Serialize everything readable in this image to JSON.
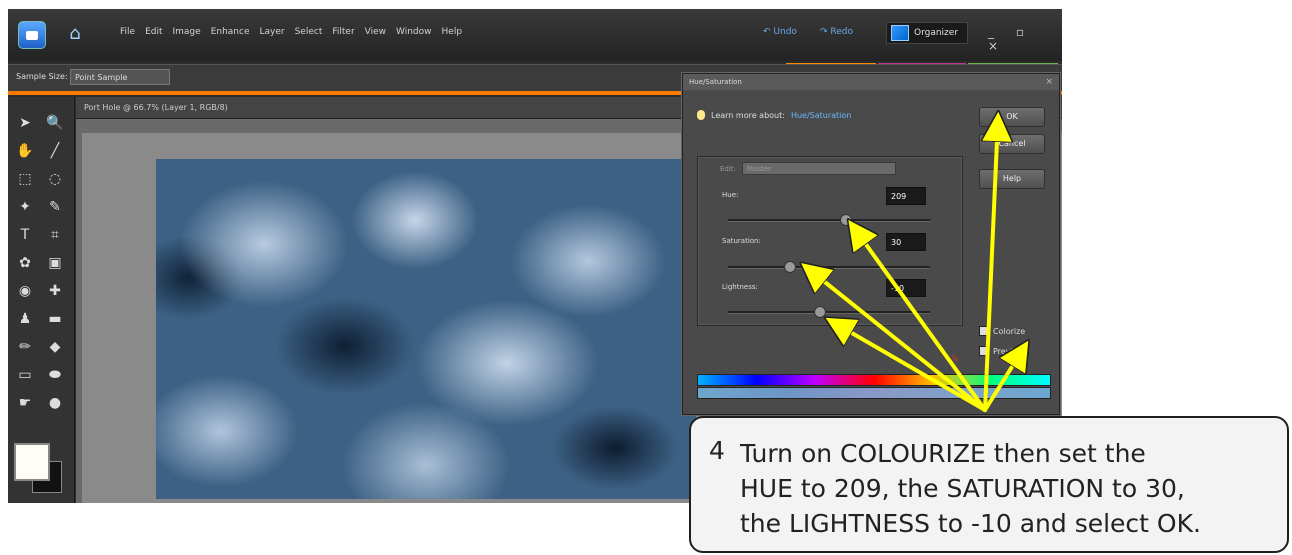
{
  "menubar": {
    "items": [
      "File",
      "Edit",
      "Image",
      "Enhance",
      "Layer",
      "Select",
      "Filter",
      "View",
      "Window",
      "Help"
    ],
    "undo": "Undo",
    "redo": "Redo",
    "organizer": "Organizer",
    "window_controls": "_ ▫ ×"
  },
  "options": {
    "sample_size_label": "Sample Size:",
    "sample_size_value": "Point Sample"
  },
  "toolbox": {
    "tools": [
      {
        "icon": "move-icon",
        "glyph": "➤"
      },
      {
        "icon": "zoom-icon",
        "glyph": "🔍"
      },
      {
        "icon": "hand-icon",
        "glyph": "✋"
      },
      {
        "icon": "eyedropper-icon",
        "glyph": "╱"
      },
      {
        "icon": "marquee-icon",
        "glyph": "⬚"
      },
      {
        "icon": "lasso-icon",
        "glyph": "◌"
      },
      {
        "icon": "magic-wand-icon",
        "glyph": "✦"
      },
      {
        "icon": "brush-icon",
        "glyph": "✎"
      },
      {
        "icon": "type-icon",
        "glyph": "T"
      },
      {
        "icon": "crop-icon",
        "glyph": "⌗"
      },
      {
        "icon": "cookie-cutter-icon",
        "glyph": "✿"
      },
      {
        "icon": "straighten-icon",
        "glyph": "▣"
      },
      {
        "icon": "red-eye-icon",
        "glyph": "◉"
      },
      {
        "icon": "healing-icon",
        "glyph": "✚"
      },
      {
        "icon": "stamp-icon",
        "glyph": "♟"
      },
      {
        "icon": "eraser-icon",
        "glyph": "▬"
      },
      {
        "icon": "pencil-icon",
        "glyph": "✏"
      },
      {
        "icon": "paint-bucket-icon",
        "glyph": "◆"
      },
      {
        "icon": "gradient-icon",
        "glyph": "▭"
      },
      {
        "icon": "shape-icon",
        "glyph": "⬬"
      },
      {
        "icon": "blur-icon",
        "glyph": "☛"
      },
      {
        "icon": "sponge-icon",
        "glyph": "●"
      }
    ]
  },
  "document": {
    "title": "Port Hole @ 66.7% (Layer 1, RGB/8)"
  },
  "dialog": {
    "title": "Hue/Saturation",
    "close": "×",
    "learn_prefix": "Learn more about:",
    "learn_link": "Hue/Saturation",
    "ok": "OK",
    "cancel": "Cancel",
    "help": "Help",
    "edit_label": "Edit:",
    "edit_value": "Master",
    "hue_label": "Hue:",
    "hue_value": "209",
    "hue_level": 0.58,
    "saturation_label": "Saturation:",
    "saturation_value": "30",
    "saturation_level": 0.3,
    "lightness_label": "Lightness:",
    "lightness_value": "-10",
    "lightness_level": 0.45,
    "colorize": "Colorize",
    "preview": "Preview"
  },
  "callout": {
    "number": "4",
    "lines": [
      "Turn on COLOURIZE then set the",
      "HUE to 209, the SATURATION to 30,",
      "the LIGHTNESS to -10 and select OK."
    ]
  },
  "colors": {
    "arrow": "#ffff00",
    "accent_orange": "#ff7a00"
  }
}
